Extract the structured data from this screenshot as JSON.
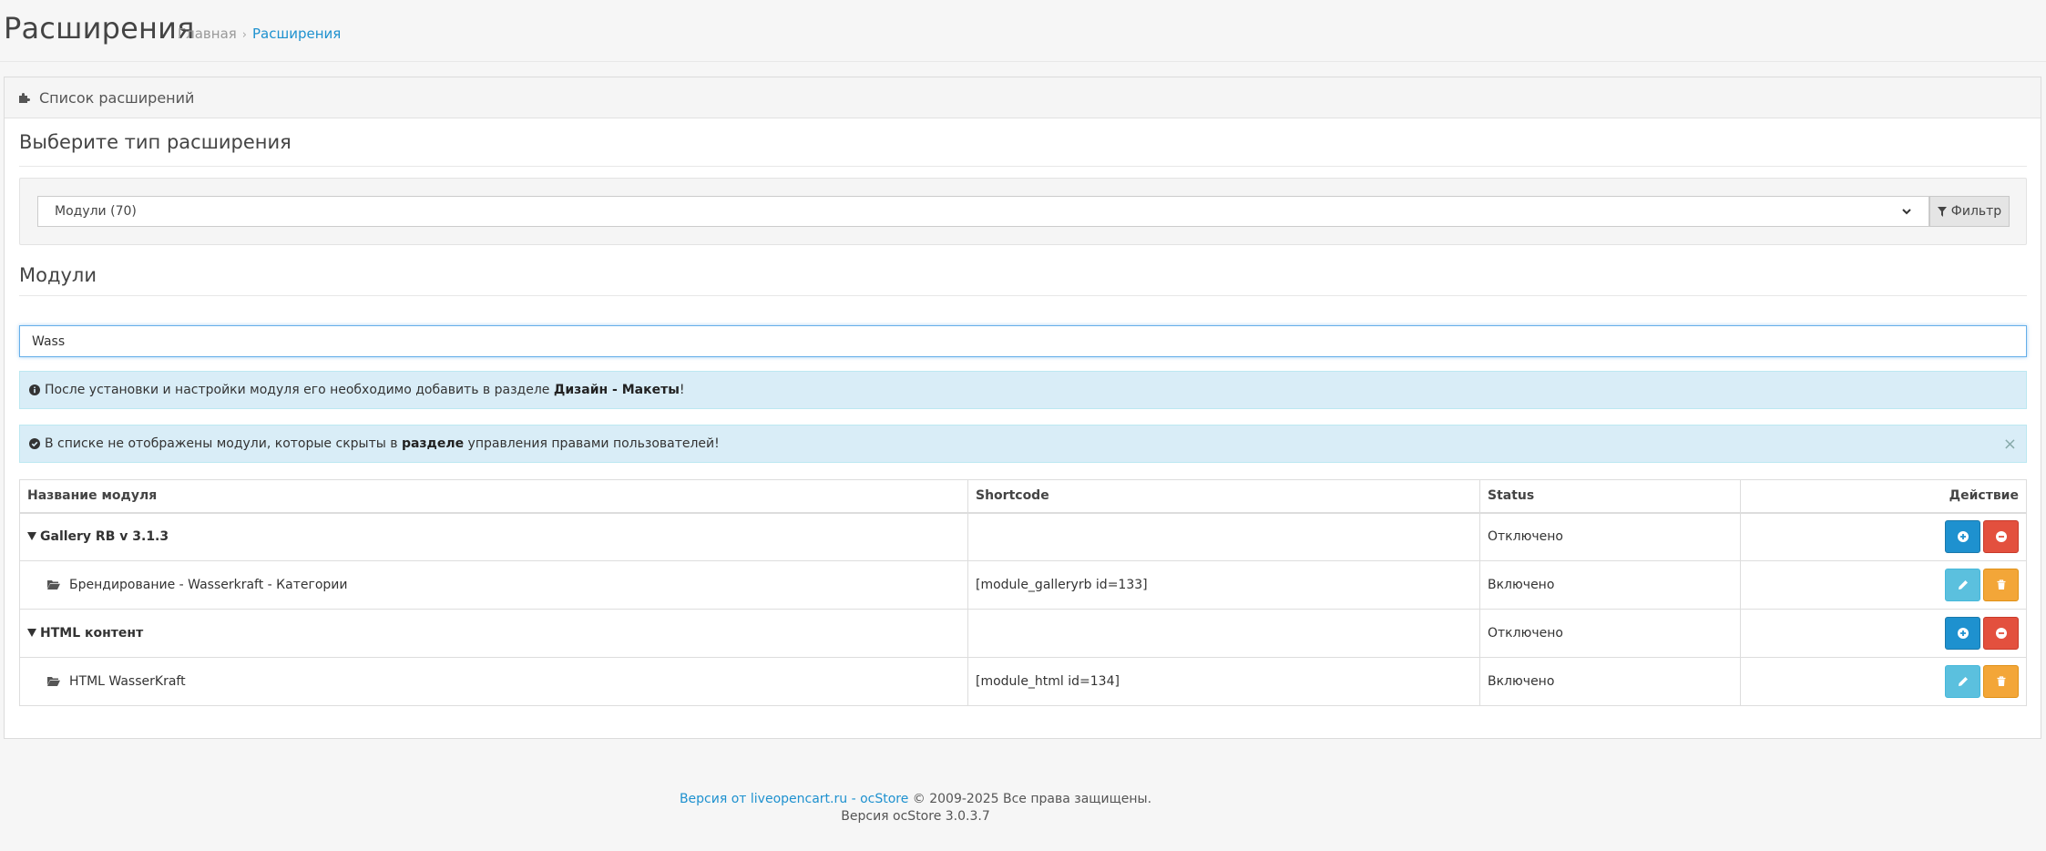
{
  "header": {
    "title": "Расширения",
    "breadcrumb": {
      "home": "Главная",
      "sep": "›",
      "current": "Расширения"
    }
  },
  "panel": {
    "heading": "Список расширений",
    "type_section_title": "Выберите тип расширения",
    "select_value": "Модули (70)",
    "filter_label": "Фильтр",
    "modules_title": "Модули",
    "search_value": "Wass"
  },
  "alerts": {
    "first": {
      "before": "После установки и настройки модуля его необходимо добавить в разделе ",
      "bold": "Дизайн - Макеты",
      "after": "!"
    },
    "second": {
      "before": "В списке не отображены модули, которые скрыты в ",
      "bold": "разделе",
      "after": " управления правами пользователей!",
      "close": "×"
    }
  },
  "table": {
    "headers": {
      "name": "Название модуля",
      "shortcode": "Shortcode",
      "status": "Status",
      "action": "Действие"
    },
    "rows": [
      {
        "name": "Gallery RB v 3.1.3",
        "shortcode": "",
        "status": "Отключено"
      },
      {
        "name": "Брендирование - Wasserkraft - Категории",
        "shortcode": "[module_galleryrb id=133]",
        "status": "Включено"
      },
      {
        "name": "HTML контент",
        "shortcode": "",
        "status": "Отключено"
      },
      {
        "name": "HTML WasserKraft",
        "shortcode": "[module_html id=134]",
        "status": "Включено"
      }
    ]
  },
  "footer": {
    "link1": "Версия от liveopencart.ru",
    "dash": " - ",
    "link2": "ocStore",
    "copy": " © 2009-2025 Все права защищены.",
    "version": "Версия ocStore 3.0.3.7"
  },
  "colors": {
    "primary": "#1e91cf",
    "danger": "#e3503e",
    "info": "#5bc0de",
    "warning": "#f3a638",
    "alert_bg": "#d9edf7"
  },
  "icons": {
    "heading": "puzzle-icon",
    "filter": "filter-icon",
    "alert1": "info-circle-icon",
    "alert2": "check-circle-icon",
    "group_toggle": "caret-down-icon",
    "module": "folder-open-icon",
    "install": "plus-circle-icon",
    "uninstall": "minus-circle-icon",
    "edit": "pencil-icon",
    "delete": "trash-icon"
  }
}
